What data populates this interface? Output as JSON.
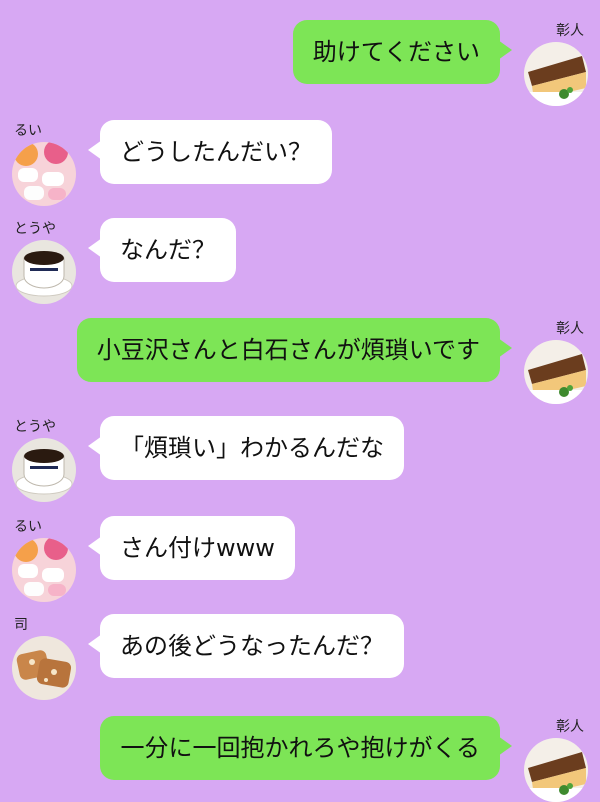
{
  "messages": [
    {
      "sender": "彰人",
      "text": "助けてください",
      "avatar_icon": "cheesecake-avatar-icon"
    },
    {
      "sender": "るい",
      "text": "どうしたんだい？",
      "avatar_icon": "marshmallow-avatar-icon"
    },
    {
      "sender": "とうや",
      "text": "なんだ？",
      "avatar_icon": "coffee-avatar-icon"
    },
    {
      "sender": "彰人",
      "text": "小豆沢さんと白石さんが煩瑣いです",
      "avatar_icon": "cheesecake-avatar-icon"
    },
    {
      "sender": "とうや",
      "text": "「煩瑣い」わかるんだな",
      "avatar_icon": "coffee-avatar-icon"
    },
    {
      "sender": "るい",
      "text": "さん付けwww",
      "avatar_icon": "marshmallow-avatar-icon"
    },
    {
      "sender": "司",
      "text": "あの後どうなったんだ？",
      "avatar_icon": "pastry-avatar-icon"
    },
    {
      "sender": "彰人",
      "text": "一分に一回抱かれろや抱けがくる",
      "avatar_icon": "cheesecake-avatar-icon"
    }
  ],
  "colors": {
    "background": "#d7a8f3",
    "outgoing_bubble": "#7de556",
    "incoming_bubble": "#ffffff"
  }
}
